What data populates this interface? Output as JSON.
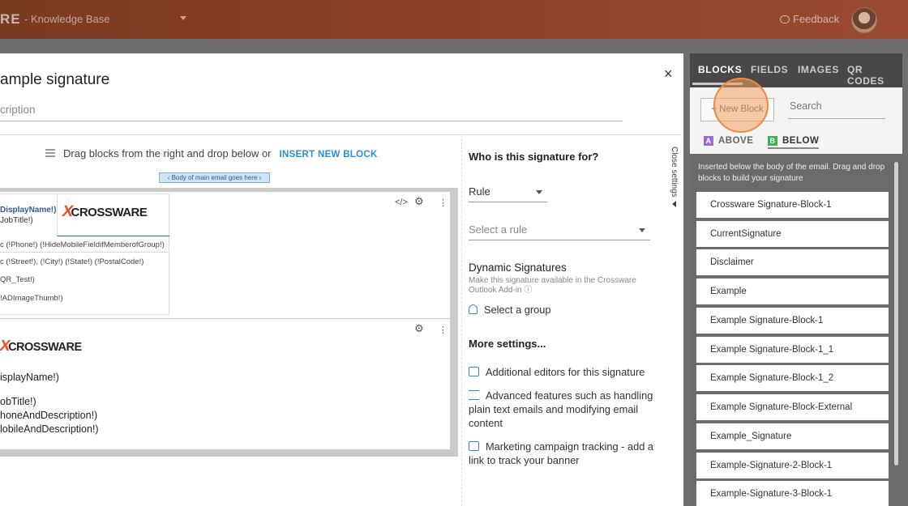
{
  "header": {
    "brand": "RE",
    "workspace": "- Knowledge Base",
    "feedback": "Feedback"
  },
  "dialog": {
    "title": "ample signature",
    "description_placeholder": "cription",
    "close": "×",
    "drag_hint": "Drag blocks from the right and drop below or",
    "insert_new_block": "INSERT NEW BLOCK",
    "body_tag": "‹ Body of main email goes here ›",
    "block1": {
      "display_name": "DisplayName!)",
      "job_title": "JobTitle!)",
      "phone_row": "c (!Phone!) (!HideMobileFieldifMemberofGroup!)",
      "address_row": "c (!Street!), (!City!) (!State!) (!PostalCode!)",
      "qr_row": "QR_Test!)",
      "image_row": "!ADImageThumb!)",
      "logo_text": "CROSSWARE"
    },
    "block2": {
      "logo_text": "CROSSWARE",
      "display_name": "isplayName!)",
      "job_title": "obTitle!)",
      "phone": "honeAndDescription!)",
      "mobile": "lobileAndDescription!)"
    },
    "block_tools": {
      "code": "</>",
      "settings": "⚙",
      "more": "⋮"
    }
  },
  "settings": {
    "who_heading": "Who is this signature for?",
    "rule_value": "Rule",
    "select_rule_placeholder": "Select a rule",
    "dynamic_heading": "Dynamic Signatures",
    "dynamic_desc": "Make this signature available in the Crossware Outlook Add-in ⓘ",
    "select_group": "Select a group",
    "more_heading": "More settings...",
    "editors": "Additional editors for this signature",
    "advanced": "Advanced features such as handling plain text emails and modifying email content",
    "marketing": "Marketing campaign tracking - add a link to track your banner",
    "close_settings": "Close settings"
  },
  "panel": {
    "tabs": [
      "BLOCKS",
      "FIELDS",
      "IMAGES",
      "QR CODES"
    ],
    "new_block": "+ New Block",
    "search_placeholder": "Search",
    "above": "ABOVE",
    "below": "BELOW",
    "above_badge": "A",
    "below_badge": "B",
    "note": "Inserted below the body of the email. Drag and drop blocks to build your signature",
    "items": [
      "Crossware Signature-Block-1",
      "CurrentSignature",
      "Disclaimer",
      "Example",
      "Example Signature-Block-1",
      "Example Signature-Block-1_1",
      "Example Signature-Block-1_2",
      "Example Signature-Block-External",
      "Example_Signature",
      "Example-Signature-2-Block-1",
      "Example-Signature-3-Block-1"
    ]
  },
  "colors": {
    "accent_blue": "#2a8fd6",
    "highlight_orange": "#f08a3a",
    "badge_above": "#9b6fcf",
    "badge_below": "#3cb44b"
  }
}
